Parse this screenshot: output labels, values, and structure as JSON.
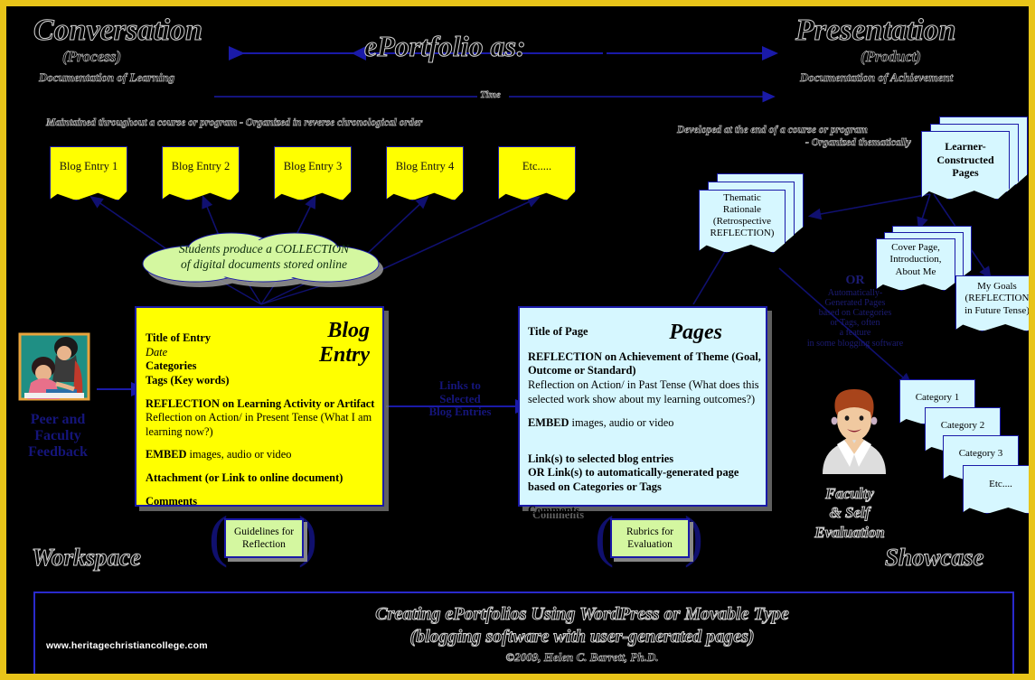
{
  "title_center": "ePortfolio as:",
  "time_label": "Time",
  "left_header": {
    "title": "Conversation",
    "subtitle": "(Process)",
    "caption": "Documentation of Learning",
    "note": "Maintained throughout a course or program - Organized in reverse chronological order"
  },
  "right_header": {
    "title": "Presentation",
    "subtitle": "(Product)",
    "caption": "Documentation of Achievement",
    "note_line1": "Developed at the end of a course or program",
    "note_line2": "- Organized thematically"
  },
  "blog_entries": [
    "Blog Entry 1",
    "Blog Entry 2",
    "Blog Entry 3",
    "Blog Entry 4",
    "Etc....."
  ],
  "cloud": {
    "line1": "Students produce a COLLECTION",
    "line2": "of digital documents stored online"
  },
  "blog_panel": {
    "heading_line1": "Blog",
    "heading_line2": "Entry",
    "title": "Title of Entry",
    "date": "Date",
    "categories": "Categories",
    "tags": "Tags (Key words)",
    "reflection_head": "REFLECTION on Learning Activity or Artifact",
    "reflection_body": "Reflection on Action/ in Present Tense (What I am learning now?)",
    "embed_bold": "EMBED",
    "embed_rest": " images, audio or video",
    "attachment": "Attachment (or Link to online document)",
    "comments": "Comments"
  },
  "pages_panel": {
    "heading": "Pages",
    "title": "Title of Page",
    "reflection_head": "REFLECTION on Achievement of Theme (Goal, Outcome or Standard)",
    "reflection_body": "Reflection on Action/ in Past Tense (What does this selected work show about my learning outcomes?)",
    "embed_bold": "EMBED",
    "embed_rest": " images, audio or video",
    "links_line1": "Link(s) to selected blog entries",
    "links_line2": "OR Link(s) to automatically-generated page",
    "links_line3": "based on Categories or Tags",
    "comments": "Comments"
  },
  "middle_arrow_label": {
    "line1": "Links to",
    "line2": "Selected",
    "line3": "Blog Entries"
  },
  "peer_feedback": {
    "line1": "Peer and",
    "line2": "Faculty",
    "line3": "Feedback"
  },
  "faculty_eval": {
    "line1": "Faculty",
    "line2": "& Self",
    "line3": "Evaluation"
  },
  "or_note": {
    "line1": "OR",
    "line2": "Automatically-",
    "line3": "Generated Pages",
    "line4": "based on Categories",
    "line5": "or Tags, often",
    "line6": "a feature",
    "line7": "in some blogging software"
  },
  "learner_pages": {
    "line1": "Learner-",
    "line2": "Constructed",
    "line3": "Pages"
  },
  "thematic": {
    "line1": "Thematic",
    "line2": "Rationale",
    "line3": "(Retrospective",
    "line4": "REFLECTION)"
  },
  "cover_page": {
    "line1": "Cover Page,",
    "line2": "Introduction,",
    "line3": "About Me"
  },
  "my_goals": {
    "line1": "My Goals",
    "line2": "(REFLECTION",
    "line3": "in Future Tense)"
  },
  "categories": [
    "Category 1",
    "Category 2",
    "Category 3",
    "Etc...."
  ],
  "guidelines": {
    "line1": "Guidelines for",
    "line2": "Reflection"
  },
  "rubrics": {
    "line1": "Rubrics for",
    "line2": "Evaluation"
  },
  "workspace_label": "Workspace",
  "showcase_label": "Showcase",
  "footer": {
    "url": "www.heritagechristiancollege.com",
    "line1": "Creating ePortfolios Using WordPress or Movable Type",
    "line2": "(blogging software with user-generated pages)",
    "line3": "©2009, Helen C. Barrett, Ph.D."
  },
  "colors": {
    "frame": "#E8C419",
    "note_yellow": "#FFFF00",
    "page_cyan": "#D6F7FF",
    "callout_green": "#D4F7A0",
    "arrow_blue": "#1a1a9c",
    "background": "#000000"
  }
}
